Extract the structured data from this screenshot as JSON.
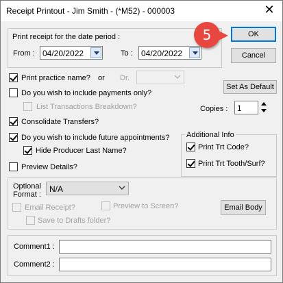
{
  "window": {
    "title": "Receipt Printout - Jim Smith - (*M52) - 000003",
    "close_label": "✕"
  },
  "period": {
    "label": "Print receipt for the date period :",
    "from_label": "From :",
    "from_value": "04/20/2022",
    "to_label": "To :",
    "to_value": "04/20/2022"
  },
  "buttons": {
    "ok": "OK",
    "cancel": "Cancel",
    "set_default": "Set As Default",
    "email_body": "Email Body"
  },
  "annotation": {
    "number": "5",
    "color": "#e8473f"
  },
  "options": {
    "print_practice_name": {
      "label": "Print practice name?",
      "checked": true
    },
    "or_label": "or",
    "dr_label": "Dr.",
    "payments_only": {
      "label": "Do you wish to include payments only?",
      "checked": false
    },
    "list_transactions": {
      "label": "List Transactions Breakdown?",
      "checked": false,
      "disabled": true
    },
    "copies_label": "Copies :",
    "copies_value": "1",
    "consolidate": {
      "label": "Consolidate Transfers?",
      "checked": true
    },
    "future_appts": {
      "label": "Do you wish to include future appointments?",
      "checked": true
    },
    "hide_producer": {
      "label": "Hide Producer Last Name?",
      "checked": true
    },
    "preview_details": {
      "label": "Preview Details?",
      "checked": false
    }
  },
  "additional_info": {
    "title": "Additional Info",
    "trt_code": {
      "label": "Print Trt Code?",
      "checked": true
    },
    "trt_tooth": {
      "label": "Print Trt Tooth/Surf?",
      "checked": true
    }
  },
  "format": {
    "label_line1": "Optional",
    "label_line2": "Format :",
    "value": "N/A",
    "email_receipt": {
      "label": "Email Receipt?",
      "checked": false
    },
    "preview_screen": {
      "label": "Preview to Screen?",
      "checked": false
    },
    "save_drafts": {
      "label": "Save to Drafts folder?",
      "checked": false
    }
  },
  "comments": {
    "comment1_label": "Comment1 :",
    "comment1_value": "",
    "comment2_label": "Comment2 :",
    "comment2_value": ""
  },
  "colors": {
    "accent": "#0078d7",
    "dropdown_arrow": "#1a3e7a"
  }
}
